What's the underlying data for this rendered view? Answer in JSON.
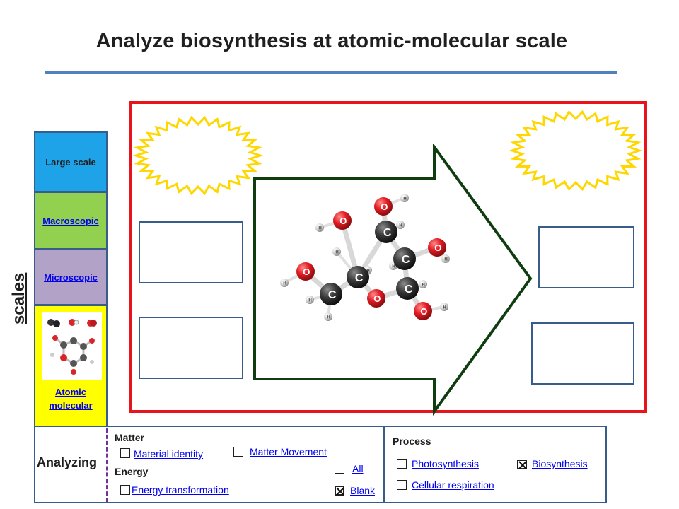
{
  "title": "Analyze biosynthesis at atomic-molecular scale",
  "scales_label": "scales",
  "scale_levels": {
    "large": "Large scale",
    "macroscopic": "Macroscopic",
    "microscopic": "Microscopic",
    "atomic_line1": "Atomic",
    "atomic_line2": "molecular"
  },
  "molecule_atoms": {
    "carbon": "C",
    "oxygen": "O",
    "hydrogen": "H"
  },
  "analyzing": {
    "label": "Analyzing",
    "matter_heading": "Matter",
    "energy_heading": "Energy",
    "options": {
      "material_identity": {
        "label": "Material identity",
        "checked": false
      },
      "matter_movement": {
        "label": "Matter Movement",
        "checked": false
      },
      "all": {
        "label": "All",
        "checked": false
      },
      "energy_transformation": {
        "label": "Energy transformation",
        "checked": false
      },
      "blank": {
        "label": "Blank",
        "checked": true
      }
    }
  },
  "process": {
    "heading": "Process",
    "options": {
      "photosynthesis": {
        "label": "Photosynthesis",
        "checked": false
      },
      "biosynthesis": {
        "label": "Biosynthesis",
        "checked": true
      },
      "cellular_respiration": {
        "label": "Cellular respiration",
        "checked": false
      }
    }
  },
  "colors": {
    "frame_red": "#e8141b",
    "arrow_green": "#0f3d0f",
    "burst_yellow": "#ffd700",
    "box_blue": "#385d8a",
    "large_scale": "#1ea3e8",
    "macroscopic": "#92d050",
    "microscopic": "#b3a2c7",
    "atomic": "#ffff00"
  }
}
